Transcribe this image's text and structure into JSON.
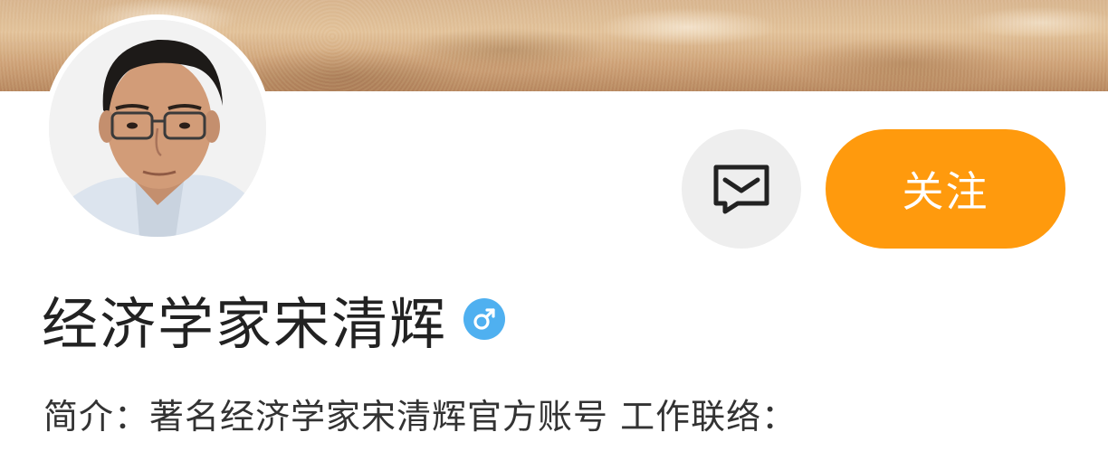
{
  "banner": {
    "image": "sand-texture-banner"
  },
  "profile": {
    "avatar": "avatar-photo",
    "name": "经济学家宋清辉",
    "gender_icon": "male-symbol-icon",
    "bio": "简介：著名经济学家宋清辉官方账号 工作联络："
  },
  "actions": {
    "message_icon": "message-icon",
    "follow_label": "关注"
  },
  "colors": {
    "follow_button": "#ff9a0d",
    "gender_badge": "#4fb0f0",
    "message_button_bg": "#eeeeee"
  }
}
